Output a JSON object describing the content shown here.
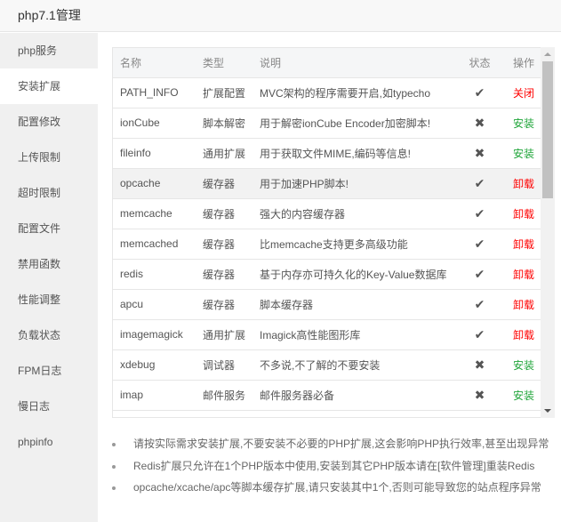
{
  "title": "php7.1管理",
  "sidebar": [
    "php服务",
    "安装扩展",
    "配置修改",
    "上传限制",
    "超时限制",
    "配置文件",
    "禁用函数",
    "性能调整",
    "负载状态",
    "FPM日志",
    "慢日志",
    "phpinfo"
  ],
  "active": 1,
  "table": {
    "headers": [
      "名称",
      "类型",
      "说明",
      "状态",
      "操作"
    ],
    "rows": [
      {
        "name": "PATH_INFO",
        "type": "扩展配置",
        "desc": "MVC架构的程序需要开启,如typecho",
        "status": "✔",
        "action": "关闭",
        "color": "red"
      },
      {
        "name": "ionCube",
        "type": "脚本解密",
        "desc": "用于解密ionCube Encoder加密脚本!",
        "status": "✖",
        "action": "安装",
        "color": "green"
      },
      {
        "name": "fileinfo",
        "type": "通用扩展",
        "desc": "用于获取文件MIME,编码等信息!",
        "status": "✖",
        "action": "安装",
        "color": "green"
      },
      {
        "name": "opcache",
        "type": "缓存器",
        "desc": "用于加速PHP脚本!",
        "status": "✔",
        "action": "卸载",
        "color": "red"
      },
      {
        "name": "memcache",
        "type": "缓存器",
        "desc": "强大的内容缓存器",
        "status": "✔",
        "action": "卸载",
        "color": "red"
      },
      {
        "name": "memcached",
        "type": "缓存器",
        "desc": "比memcache支持更多高级功能",
        "status": "✔",
        "action": "卸载",
        "color": "red"
      },
      {
        "name": "redis",
        "type": "缓存器",
        "desc": "基于内存亦可持久化的Key-Value数据库",
        "status": "✔",
        "action": "卸载",
        "color": "red"
      },
      {
        "name": "apcu",
        "type": "缓存器",
        "desc": "脚本缓存器",
        "status": "✔",
        "action": "卸载",
        "color": "red"
      },
      {
        "name": "imagemagick",
        "type": "通用扩展",
        "desc": "Imagick高性能图形库",
        "status": "✔",
        "action": "卸载",
        "color": "red"
      },
      {
        "name": "xdebug",
        "type": "调试器",
        "desc": "不多说,不了解的不要安装",
        "status": "✖",
        "action": "安装",
        "color": "green"
      },
      {
        "name": "imap",
        "type": "邮件服务",
        "desc": "邮件服务器必备",
        "status": "✖",
        "action": "安装",
        "color": "green"
      }
    ]
  },
  "notes": [
    "请按实际需求安装扩展,不要安装不必要的PHP扩展,这会影响PHP执行效率,甚至出现异常",
    "Redis扩展只允许在1个PHP版本中使用,安装到其它PHP版本请在[软件管理]重装Redis",
    "opcache/xcache/apc等脚本缓存扩展,请只安装其中1个,否则可能导致您的站点程序异常"
  ]
}
